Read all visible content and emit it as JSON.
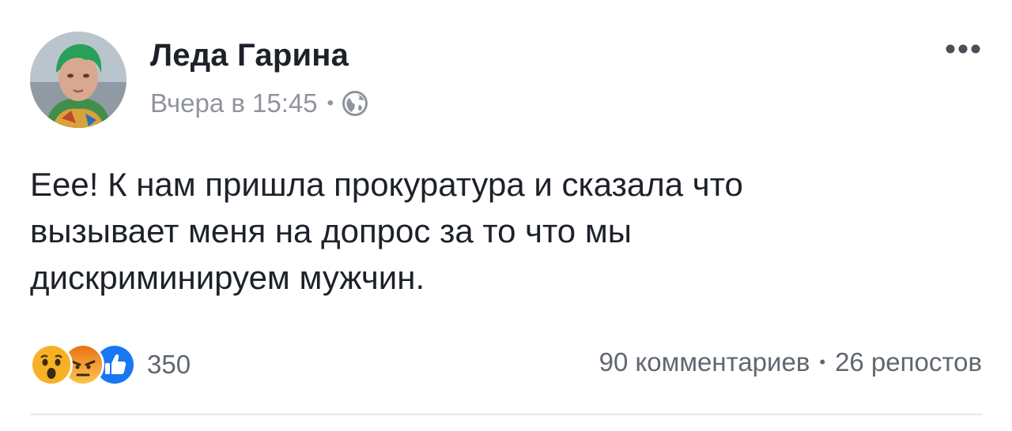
{
  "post": {
    "author": "Леда Гарина",
    "timestamp": "Вчера в 15:45",
    "separator": "•",
    "privacy_icon": "globe-icon",
    "menu_icon": "more-horizontal-icon",
    "text": "Еее! К нам пришла прокуратура и сказала что\nвызывает меня на допрос за то что мы\nдискриминируем мужчин."
  },
  "footer": {
    "reactions": [
      {
        "type": "wow",
        "icon": "wow-reaction-icon",
        "color": "#f7b125"
      },
      {
        "type": "angry",
        "icon": "angry-reaction-icon",
        "color": "#e9710f"
      },
      {
        "type": "like",
        "icon": "like-reaction-icon",
        "color": "#1877f2"
      }
    ],
    "reaction_count": "350",
    "comments": "90 комментариев",
    "separator": "•",
    "shares": "26 репостов"
  },
  "colors": {
    "text": "#1d2129",
    "secondary": "#90949c",
    "divider": "#e4e6eb"
  }
}
